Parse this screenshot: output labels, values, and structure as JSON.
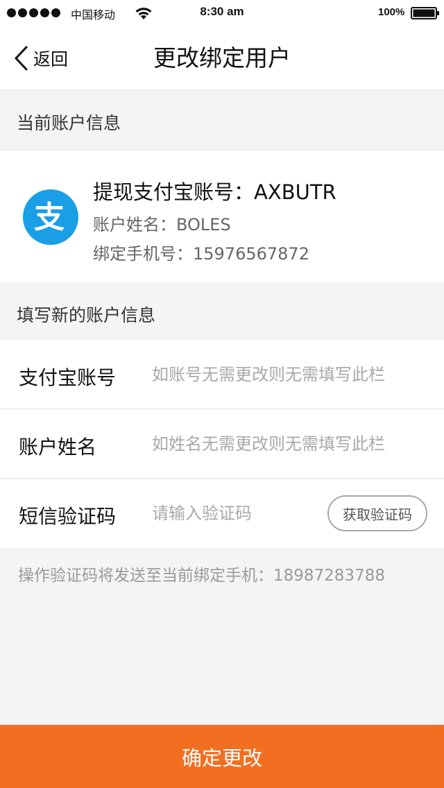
{
  "status_bar": {
    "carrier": "中国移动",
    "time": "8:30 am",
    "battery": "100%"
  },
  "nav": {
    "back_label": "返回",
    "title": "更改绑定用户"
  },
  "current_section": {
    "header": "当前账户信息",
    "alipay_account": "提现支付宝账号：AXBUTR",
    "account_name": "账户姓名：BOLES",
    "bound_phone": "绑定手机号：15976567872",
    "logo_glyph": "支",
    "logo_color": "#1a9ee6"
  },
  "new_section": {
    "header": "填写新的账户信息",
    "fields": [
      {
        "label": "支付宝账号",
        "value": "",
        "placeholder": "如账号无需更改则无需填写此栏"
      },
      {
        "label": "账户姓名",
        "value": "",
        "placeholder": "如姓名无需更改则无需填写此栏"
      },
      {
        "label": "短信验证码",
        "value": "",
        "placeholder": "请输入验证码"
      }
    ],
    "get_code_label": "获取验证码"
  },
  "hint": "操作验证码将发送至当前绑定手机：18987283788",
  "confirm_label": "确定更改",
  "colors": {
    "accent": "#f26f21",
    "alipay_blue": "#1a9ee6"
  }
}
